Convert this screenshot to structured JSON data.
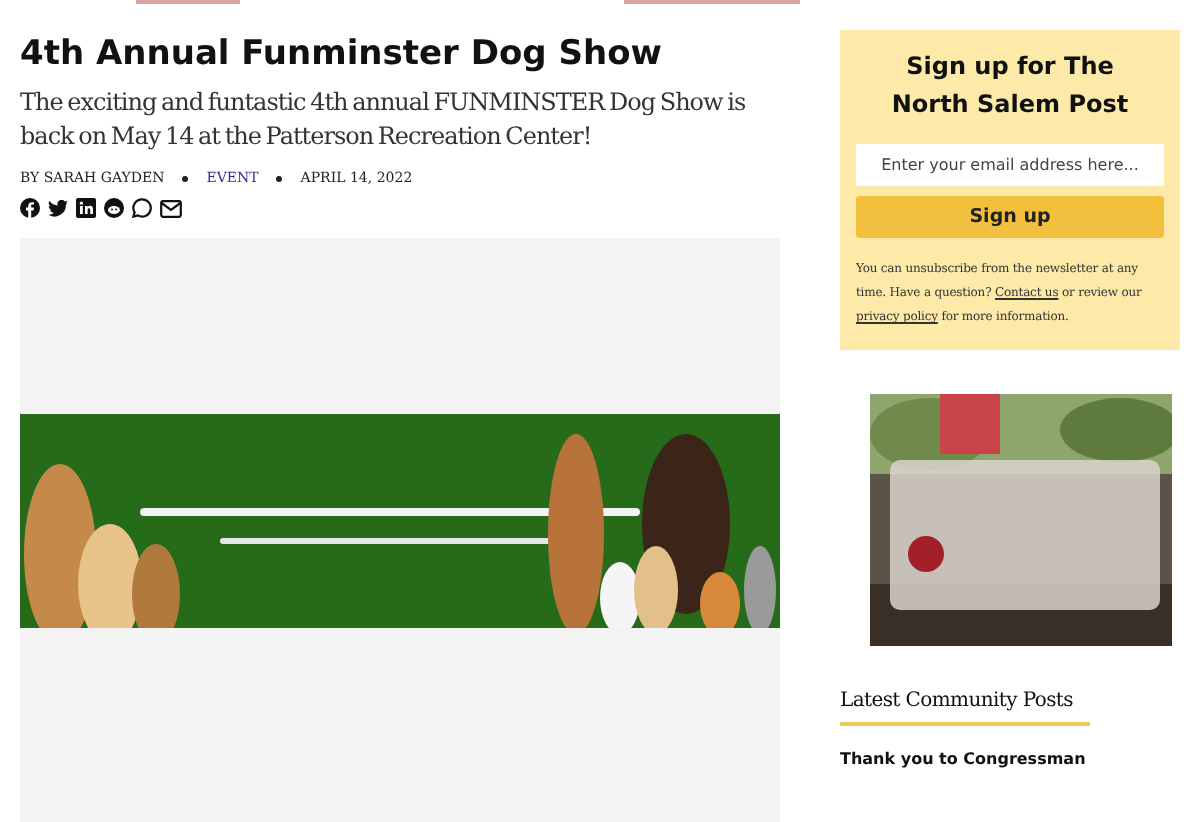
{
  "article": {
    "title": "4th Annual Funminster Dog Show",
    "subtitle": "The exciting and funtastic 4th annual FUNMINSTER Dog Show is back on May 14 at the Patterson Recreation Center!",
    "byline": "BY SARAH GAYDEN",
    "category": "EVENT",
    "date": "APRIL 14, 2022",
    "share_icons": [
      {
        "kind": "facebook"
      },
      {
        "kind": "twitter"
      },
      {
        "kind": "linkedin"
      },
      {
        "kind": "reddit"
      },
      {
        "kind": "whatsapp"
      },
      {
        "kind": "email"
      }
    ]
  },
  "sidebar": {
    "signup": {
      "title": "Sign up for The North Salem Post",
      "email": {
        "placeholder": "Enter your email address here..."
      },
      "button": "Sign up",
      "note_before": "You can unsubscribe from the newsletter at any time. Have a question?",
      "contact_link": "Contact us",
      "note_middle": "or review our",
      "privacy_link": "privacy policy",
      "note_after": "for more information."
    },
    "latest": {
      "heading": "Latest Community Posts",
      "posts": [
        "Thank you to Congressman"
      ]
    }
  }
}
